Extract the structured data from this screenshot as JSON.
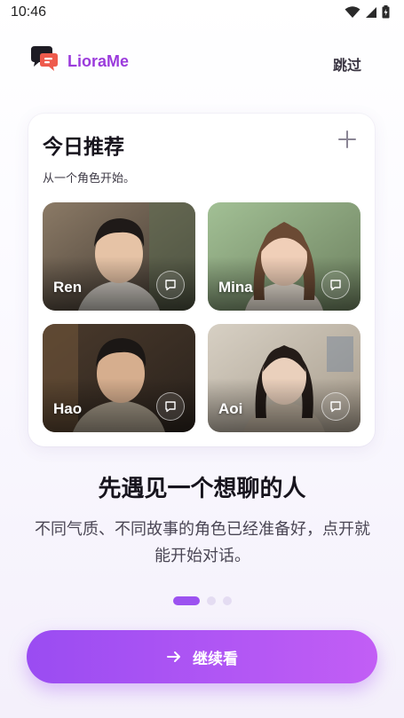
{
  "status": {
    "time": "10:46"
  },
  "header": {
    "brand": "LioraMe",
    "skip_label": "跳过"
  },
  "card": {
    "title": "今日推荐",
    "subtitle": "从一个角色开始。",
    "characters": [
      {
        "name": "Ren"
      },
      {
        "name": "Mina"
      },
      {
        "name": "Hao"
      },
      {
        "name": "Aoi"
      }
    ]
  },
  "onboarding": {
    "headline": "先遇见一个想聊的人",
    "description": "不同气质、不同故事的角色已经准备好，点开就能开始对话。",
    "page_index": 1,
    "page_count": 3
  },
  "cta": {
    "label": "继续看"
  },
  "colors": {
    "accent": "#9c52f0",
    "brand": "#9b3bdc"
  }
}
